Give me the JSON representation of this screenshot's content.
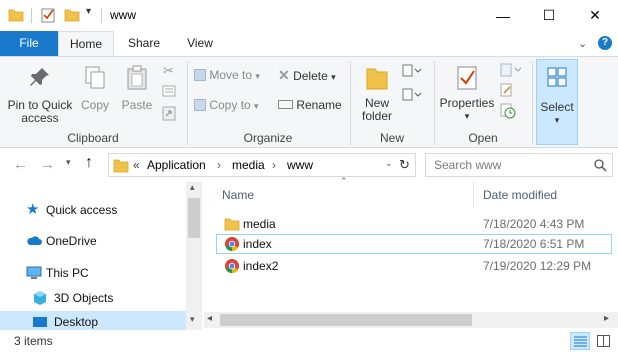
{
  "window": {
    "title": "www",
    "minimize": "—",
    "maximize": "☐",
    "close": "✕"
  },
  "tabs": [
    {
      "label": "File"
    },
    {
      "label": "Home"
    },
    {
      "label": "Share"
    },
    {
      "label": "View"
    }
  ],
  "ribbon": {
    "clipboard": {
      "group_label": "Clipboard",
      "pin_label": "Pin to Quick access",
      "pin_l1": "Pin to Quick",
      "pin_l2": "access",
      "copy": "Copy",
      "paste": "Paste"
    },
    "organize": {
      "group_label": "Organize",
      "move_to": "Move to",
      "copy_to": "Copy to",
      "delete": "Delete",
      "rename": "Rename"
    },
    "new": {
      "group_label": "New",
      "new_folder_l1": "New",
      "new_folder_l2": "folder"
    },
    "open": {
      "group_label": "Open",
      "properties": "Properties"
    },
    "select": {
      "label": "Select"
    }
  },
  "address": {
    "prefix": "«",
    "path": [
      "Application",
      "media",
      "www"
    ],
    "search_placeholder": "Search www"
  },
  "nav_pane": [
    {
      "label": "Quick access"
    },
    {
      "label": "OneDrive"
    },
    {
      "label": "This PC"
    },
    {
      "label": "3D Objects"
    },
    {
      "label": "Desktop"
    }
  ],
  "columns": {
    "name": "Name",
    "date": "Date modified"
  },
  "files": [
    {
      "name": "media",
      "date": "7/18/2020 4:43 PM",
      "type": "folder"
    },
    {
      "name": "index",
      "date": "7/18/2020 6:51 PM",
      "type": "chrome"
    },
    {
      "name": "index2",
      "date": "7/19/2020 12:29 PM",
      "type": "chrome"
    }
  ],
  "status": {
    "items": "3 items"
  },
  "colors": {
    "accent": "#1979ca",
    "folder": "#f0c24a",
    "ribbon_bg": "#f5f6f7",
    "select_bg": "#cce8ff"
  }
}
